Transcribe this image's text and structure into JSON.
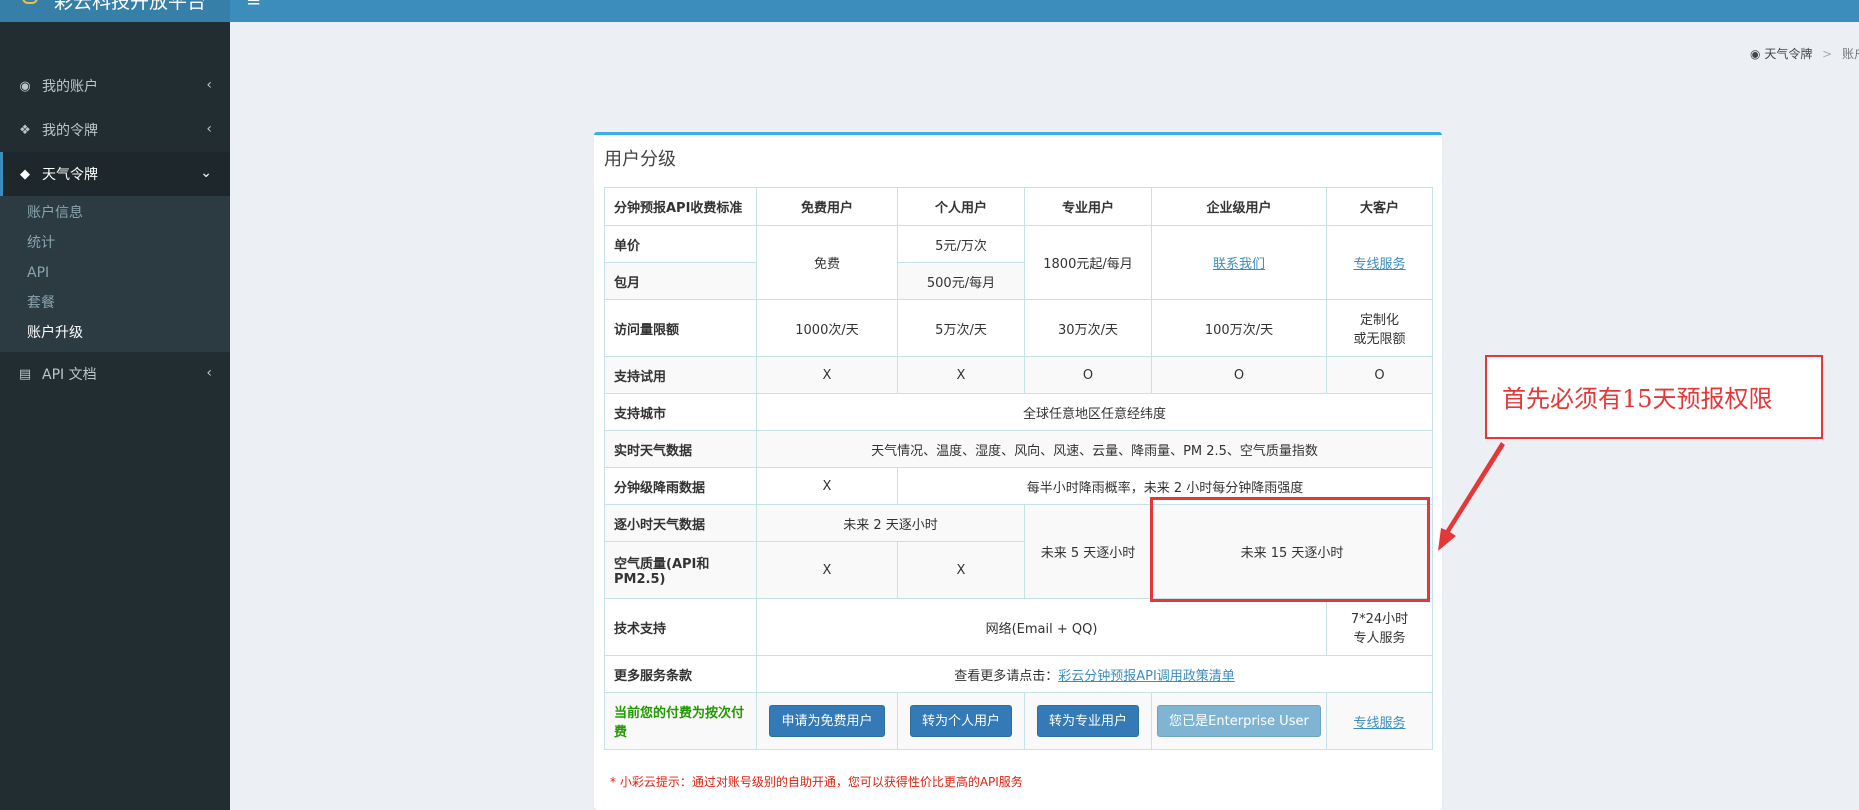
{
  "header": {
    "logo_text": "彩云科技开放平台",
    "toggle_icon": "≡"
  },
  "sidebar": {
    "items": [
      {
        "label": "我的账户",
        "icon": "dashboard-icon",
        "chevron": "‹"
      },
      {
        "label": "我的令牌",
        "icon": "cubes-icon",
        "chevron": "‹"
      },
      {
        "label": "天气令牌",
        "icon": "cube-icon",
        "chevron": "⌄",
        "active": true
      },
      {
        "label": "API 文档",
        "icon": "book-icon",
        "chevron": "‹"
      }
    ],
    "submenu": [
      "账户信息",
      "统计",
      "API",
      "套餐",
      "账户升级"
    ]
  },
  "breadcrumb": {
    "home": "天气令牌",
    "sep": ">",
    "current": "账户"
  },
  "box": {
    "title": "用户分级"
  },
  "table": {
    "headers": [
      "分钟预报API收费标准",
      "免费用户",
      "个人用户",
      "专业用户",
      "企业级用户",
      "大客户"
    ],
    "price_row": {
      "label": "单价",
      "free": "免费",
      "personal": "5元/万次",
      "pro": "1800元起/每月",
      "enterprise": "联系我们",
      "big": "专线服务"
    },
    "monthly_row": {
      "label": "包月",
      "personal": "500元/每月"
    },
    "limit_row": {
      "label": "访问量限额",
      "free": "1000次/天",
      "personal": "5万次/天",
      "pro": "30万次/天",
      "enterprise": "100万次/天",
      "big_line1": "定制化",
      "big_line2": "或无限额"
    },
    "trial_row": {
      "label": "支持试用",
      "free": "X",
      "personal": "X",
      "pro": "O",
      "enterprise": "O",
      "big": "O"
    },
    "city_row": {
      "label": "支持城市",
      "value": "全球任意地区任意经纬度"
    },
    "realtime_row": {
      "label": "实时天气数据",
      "value": "天气情况、温度、湿度、风向、风速、云量、降雨量、PM 2.5、空气质量指数"
    },
    "minute_row": {
      "label": "分钟级降雨数据",
      "free": "X",
      "value": "每半小时降雨概率，未来 2 小时每分钟降雨强度"
    },
    "hourly_row": {
      "label": "逐小时天气数据",
      "free_personal": "未来 2 天逐小时",
      "pro": "未来 5 天逐小时",
      "enterprise": "未来 15 天逐小时"
    },
    "aqi_row": {
      "label": "空气质量(API和PM2.5)",
      "free": "X",
      "personal": "X"
    },
    "support_row": {
      "label": "技术支持",
      "value": "网络(Email + QQ)",
      "big_line1": "7*24小时",
      "big_line2": "专人服务"
    },
    "terms_row": {
      "label": "更多服务条款",
      "prefix": "查看更多请点击：",
      "link": "彩云分钟预报API调用政策清单"
    },
    "action_row": {
      "label": "当前您的付费为按次付费",
      "btn_free": "申请为免费用户",
      "btn_personal": "转为个人用户",
      "btn_pro": "转为专业用户",
      "btn_enterprise": "您已是Enterprise User",
      "big": "专线服务"
    }
  },
  "tip": "* 小彩云提示：通过对账号级别的自助开通，您可以获得性价比更高的API服务",
  "annotation": {
    "text": "首先必须有15天预报权限"
  },
  "colors": {
    "topbar": "#3c8dbc",
    "sidebar": "#222d32",
    "accent": "#3ab0e6",
    "annotation": "#e43838",
    "button": "#337ab7"
  }
}
